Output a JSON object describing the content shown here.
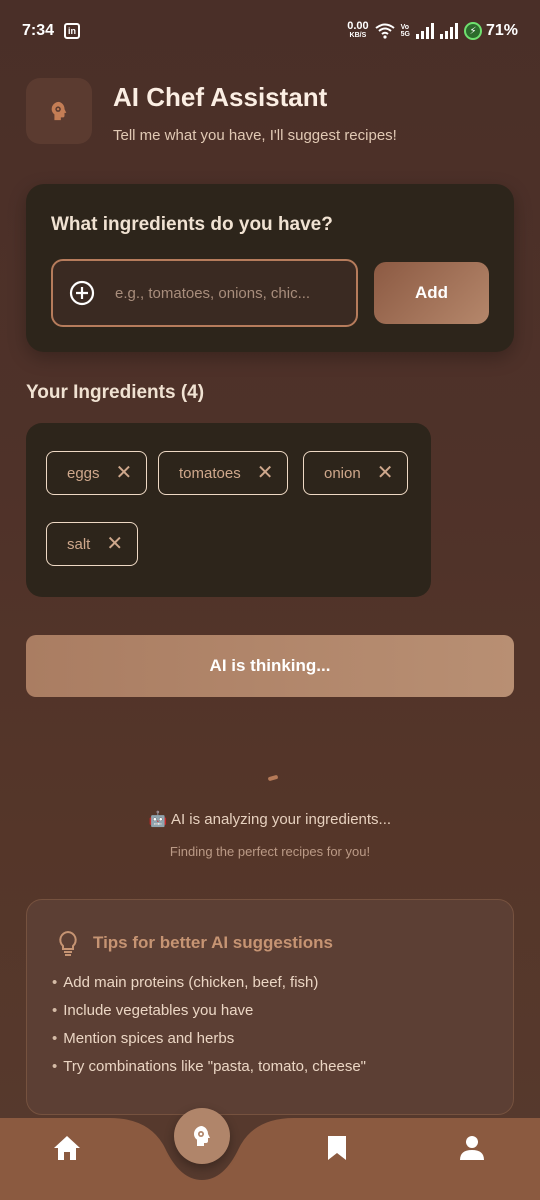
{
  "status_bar": {
    "time": "7:34",
    "net_speed": "0.00",
    "net_unit": "KB/S",
    "battery": "71%"
  },
  "header": {
    "title": "AI Chef Assistant",
    "subtitle": "Tell me what you have, I'll suggest recipes!"
  },
  "input_card": {
    "question": "What ingredients do you have?",
    "placeholder": "e.g., tomatoes, onions, chic...",
    "add_label": "Add"
  },
  "ingredients": {
    "title": "Your Ingredients (4)",
    "items": [
      "eggs",
      "tomatoes",
      "onion",
      "salt"
    ]
  },
  "ai_button": {
    "label": "AI is thinking..."
  },
  "analyzing": {
    "text": "🤖 AI is analyzing your ingredients...",
    "subtext": "Finding the perfect recipes for you!"
  },
  "tips": {
    "title": "Tips for better AI suggestions",
    "items": [
      "Add main proteins (chicken, beef, fish)",
      "Include vegetables you have",
      "Mention spices and herbs",
      "Try combinations like \"pasta, tomato, cheese\""
    ]
  },
  "nav": {
    "icons": [
      "home-icon",
      "ai-chef-icon",
      "bookmark-icon",
      "profile-icon"
    ]
  },
  "colors": {
    "accent": "#b0856a",
    "card": "#2d251b",
    "nav": "#8b5a40"
  }
}
